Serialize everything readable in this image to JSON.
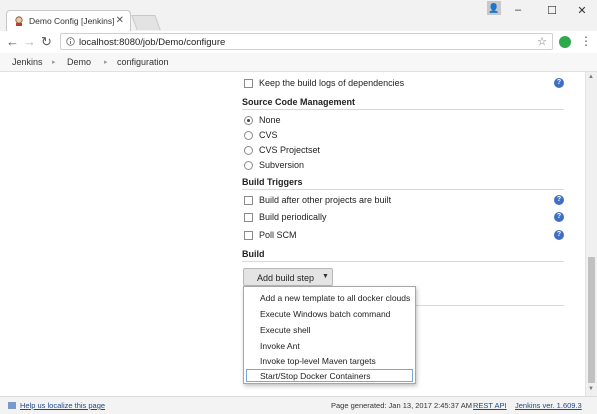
{
  "browser": {
    "tab_title": "Demo Config [Jenkins]",
    "url": "localhost:8080/job/Demo/configure",
    "accent": "#2ea84a"
  },
  "breadcrumbs": [
    "Jenkins",
    "Demo",
    "configuration"
  ],
  "config": {
    "keep_logs_label": "Keep the build logs of dependencies",
    "scm": {
      "heading": "Source Code Management",
      "options": [
        "None",
        "CVS",
        "CVS Projectset",
        "Subversion"
      ],
      "selected": "None"
    },
    "triggers": {
      "heading": "Build Triggers",
      "options": [
        "Build after other projects are built",
        "Build periodically",
        "Poll SCM"
      ]
    },
    "build": {
      "heading": "Build",
      "add_step_label": "Add build step",
      "menu": [
        "Add a new template to all docker clouds",
        "Execute Windows batch command",
        "Execute shell",
        "Invoke Ant",
        "Invoke top-level Maven targets",
        "Start/Stop Docker Containers"
      ],
      "highlighted": "Start/Stop Docker Containers"
    }
  },
  "footer": {
    "localize": "Help us localize this page",
    "generated": "Page generated: Jan 13, 2017 2:45:37 AM",
    "rest_api": "REST API",
    "version": "Jenkins ver. 1.609.3"
  }
}
